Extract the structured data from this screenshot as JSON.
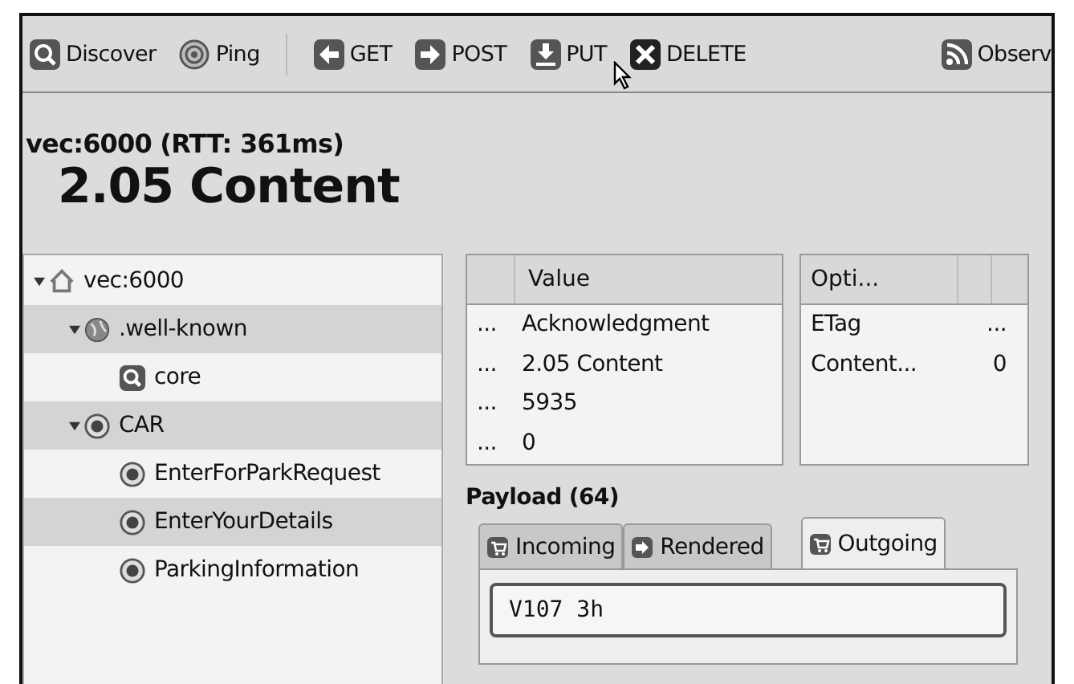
{
  "toolbar": [
    {
      "label": "Discover"
    },
    {
      "label": "Ping"
    },
    {
      "label": "GET"
    },
    {
      "label": "POST"
    },
    {
      "label": "PUT"
    },
    {
      "label": "DELETE"
    },
    {
      "label": "Observ"
    }
  ],
  "response": {
    "title": "vec:6000 (RTT: 361ms)",
    "status": "2.05 Content"
  },
  "tree": [
    {
      "label": "vec:6000",
      "kind": "host",
      "expanded": true,
      "children": [
        {
          "label": ".well-known",
          "kind": "namespace",
          "expanded": true,
          "children": [
            {
              "label": "core",
              "kind": "discovery"
            }
          ]
        },
        {
          "label": "CAR",
          "kind": "resource",
          "expanded": true,
          "children": [
            {
              "label": "EnterForParkRequest",
              "kind": "resource"
            },
            {
              "label": "EnterYourDetails",
              "kind": "resource"
            },
            {
              "label": "ParkingInformation",
              "kind": "resource"
            }
          ]
        }
      ]
    }
  ],
  "header_table": {
    "columns": [
      "",
      "Value"
    ],
    "rows": [
      [
        "...",
        "Acknowledgment"
      ],
      [
        "...",
        "2.05 Content"
      ],
      [
        "...",
        "5935"
      ],
      [
        "...",
        "0"
      ]
    ]
  },
  "options_table": {
    "columns": [
      "Opti..."
    ],
    "rows": [
      [
        "ETag",
        "..."
      ],
      [
        "Content...",
        "0"
      ]
    ]
  },
  "payload": {
    "title": "Payload (64)",
    "tabs": [
      {
        "label": "Incoming",
        "selected": false
      },
      {
        "label": "Rendered",
        "selected": false
      },
      {
        "label": "Outgoing",
        "selected": true
      }
    ],
    "value": "V107 3h"
  }
}
